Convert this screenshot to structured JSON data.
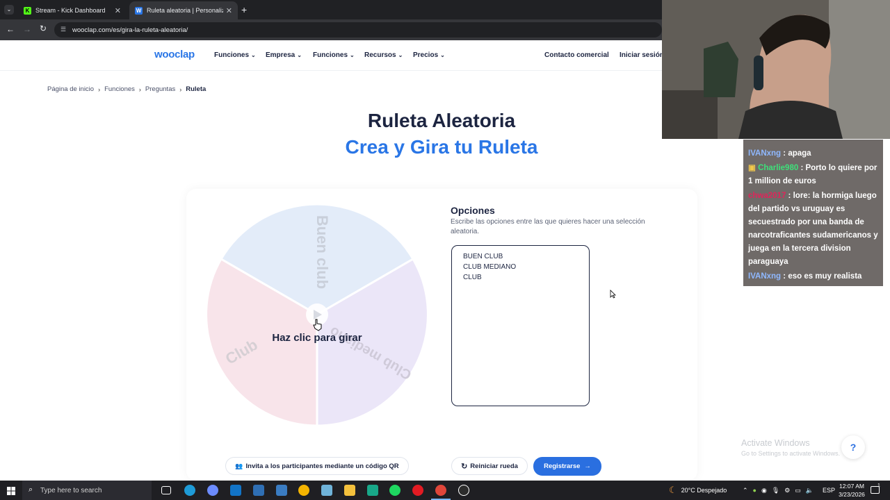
{
  "browser": {
    "tabs": [
      {
        "title": "Stream - Kick Dashboard",
        "favicon": "K",
        "active": false
      },
      {
        "title": "Ruleta aleatoria | Personaliza y gira",
        "favicon": "W",
        "active": true
      }
    ],
    "url": "wooclap.com/es/gira-la-ruleta-aleatoria/"
  },
  "site": {
    "logo": "wooclap",
    "nav": [
      "Funciones",
      "Empresa",
      "Funciones",
      "Recursos",
      "Precios"
    ],
    "contact": "Contacto comercial",
    "login": "Iniciar sesión"
  },
  "breadcrumb": [
    "Página de inicio",
    "Funciones",
    "Preguntas",
    "Ruleta"
  ],
  "hero": {
    "title": "Ruleta Aleatoria",
    "subtitle": "Crea y Gira tu Ruleta"
  },
  "wheel": {
    "center_label": "Haz clic para girar",
    "segments": [
      {
        "label": "Buen club",
        "color": "#e3ecf9"
      },
      {
        "label": "Club mediano",
        "color": "#ebe6f8"
      },
      {
        "label": "Club",
        "color": "#f8e4ea"
      }
    ]
  },
  "options": {
    "heading": "Opciones",
    "description": "Escribe las opciones entre las que quieres hacer una selección aleatoria.",
    "lines": [
      "BUEN CLUB",
      "CLUB MEDIANO",
      "CLUB"
    ]
  },
  "buttons": {
    "invite": "Invita a los participantes mediante un código QR",
    "reset": "Reiniciar rueda",
    "register": "Registrarse"
  },
  "chat": [
    {
      "user": "IVANxng",
      "color": "#8fb8ff",
      "message": "apaga"
    },
    {
      "user": "Charlie980",
      "color": "#3ee07a",
      "message": "Porto lo quiere por 1 million de euros"
    },
    {
      "user": "chwa2017",
      "color": "#e0245a",
      "message": "lore: la hormiga luego del partido vs uruguay es secuestrado por una banda de narcotraficantes sudamericanos y juega en la tercera division paraguaya"
    },
    {
      "user": "IVANxng",
      "color": "#8fb8ff",
      "message": "eso es muy realista"
    }
  ],
  "watermark": {
    "title": "Activate Windows",
    "subtitle": "Go to Settings to activate Windows."
  },
  "taskbar": {
    "search_placeholder": "Type here to search",
    "weather": "20°C  Despejado",
    "lang": "ESP",
    "time": "12:07 AM",
    "date": "3/23/2026",
    "notification_count": "1"
  }
}
